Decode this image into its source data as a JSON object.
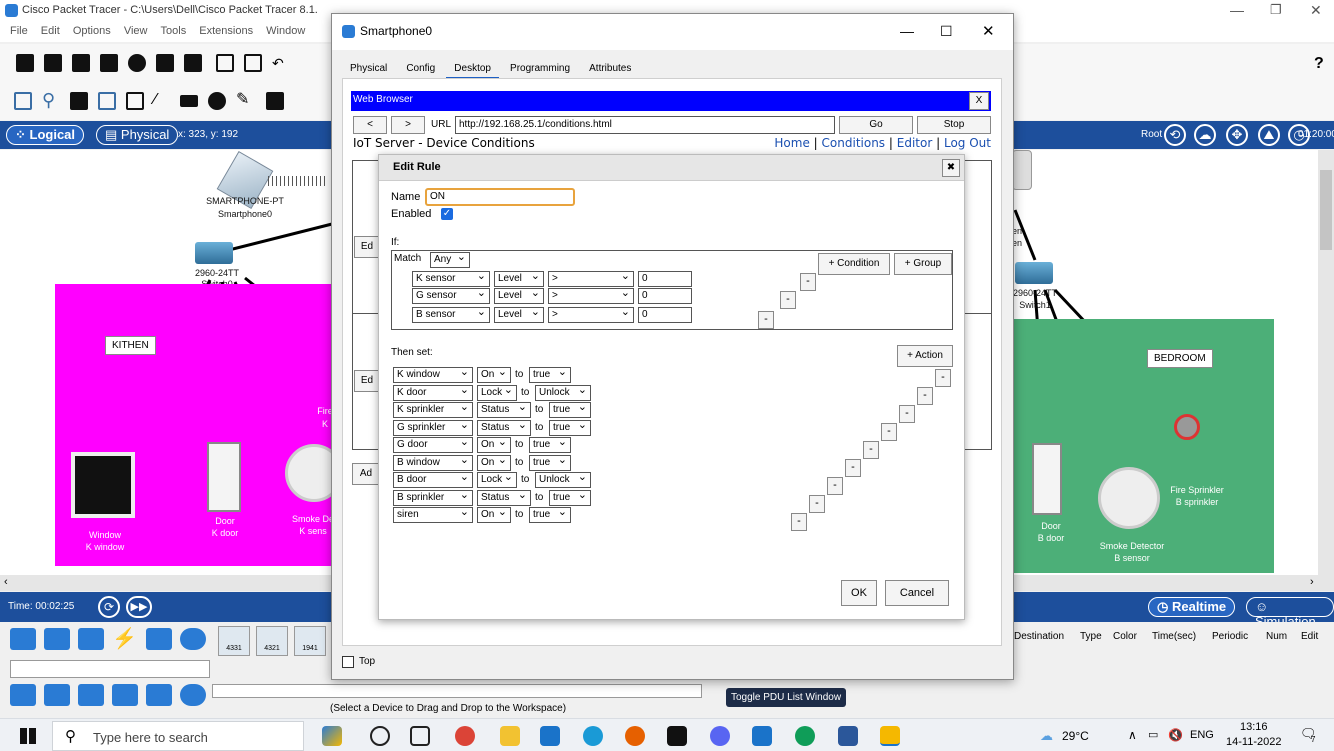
{
  "pt_window": {
    "title": "Cisco Packet Tracer - C:\\Users\\Dell\\Cisco Packet Tracer 8.1.",
    "menu": [
      "File",
      "Edit",
      "Options",
      "View",
      "Tools",
      "Extensions",
      "Window"
    ],
    "mode_logical": "Logical",
    "mode_physical": "Physical",
    "coords": "x: 323, y: 192",
    "root_label": "Root",
    "clock": "01:20:00",
    "help_label": "?"
  },
  "workspace": {
    "smartphone_label_1": "SMARTPHONE-PT",
    "smartphone_label_2": "Smartphone0",
    "switch_label": "2960-24TT",
    "switch_label_2": "Switch0",
    "kitchen_label": "KITHEN",
    "bedroom_label": "BEDROOM",
    "k_window_1": "Window",
    "k_window_2": "K window",
    "k_door_1": "Door",
    "k_door_2": "K door",
    "k_smoke_1": "Smoke De",
    "k_smoke_2": "K sens",
    "k_fire_1": "Fire",
    "k_fire_2": "K",
    "b_door_1": "Door",
    "b_door_2": "B door",
    "b_smoke_1": "Smoke Detector",
    "b_smoke_2": "B sensor",
    "b_fire_1": "Fire Sprinkler",
    "b_fire_2": "B sprinkler",
    "b_switch_label": "2960-24TT",
    "b_switch_label_2": "Switch1",
    "b_top_label_1": "en",
    "b_top_label_2": "en"
  },
  "bottom": {
    "time": "Time: 00:02:25",
    "realtime": "Realtime",
    "simulation": "Simulation",
    "pdu_columns": [
      "Destination",
      "Type",
      "Color",
      "Time(sec)",
      "Periodic",
      "Num",
      "Edit"
    ],
    "device_hint": "(Select a Device to Drag and Drop to the Workspace)",
    "toggle_pdu": "Toggle PDU List Window",
    "router_labels": [
      "4331",
      "4321",
      "1941"
    ]
  },
  "dialog": {
    "title": "Smartphone0",
    "tabs": [
      "Physical",
      "Config",
      "Desktop",
      "Programming",
      "Attributes"
    ],
    "active_tab": "Desktop",
    "web_browser_title": "Web Browser",
    "close_x": "X",
    "nav_back": "<",
    "nav_forward": ">",
    "url_label": "URL",
    "url_value": "http://192.168.25.1/conditions.html",
    "go": "Go",
    "stop": "Stop",
    "iot_title": "IoT Server - Device Conditions",
    "links": {
      "home": "Home",
      "conditions": "Conditions",
      "editor": "Editor",
      "logout": "Log Out",
      "sep": "|"
    },
    "top_checkbox_label": "Top",
    "side_buttons": [
      "Ed",
      "Ed",
      "Ad"
    ]
  },
  "edit_rule": {
    "title": "Edit Rule",
    "close": "✖",
    "name_label": "Name",
    "name_value": "ON",
    "enabled_label": "Enabled",
    "enabled": true,
    "if_label": "If:",
    "match_label": "Match",
    "match_value": "Any",
    "add_condition": "+ Condition",
    "add_group": "+ Group",
    "conditions": [
      {
        "device": "K sensor",
        "property": "Level",
        "op": ">",
        "value": "0"
      },
      {
        "device": "G sensor",
        "property": "Level",
        "op": ">",
        "value": "0"
      },
      {
        "device": "B sensor",
        "property": "Level",
        "op": ">",
        "value": "0"
      }
    ],
    "then_label": "Then set:",
    "add_action": "+ Action",
    "to_label": "to",
    "actions": [
      {
        "device": "K window",
        "property": "On",
        "value": "true"
      },
      {
        "device": "K door",
        "property": "Lock",
        "value": "Unlock"
      },
      {
        "device": "K sprinkler",
        "property": "Status",
        "value": "true"
      },
      {
        "device": "G sprinkler",
        "property": "Status",
        "value": "true"
      },
      {
        "device": "G door",
        "property": "On",
        "value": "true"
      },
      {
        "device": "B window",
        "property": "On",
        "value": "true"
      },
      {
        "device": "B door",
        "property": "Lock",
        "value": "Unlock"
      },
      {
        "device": "B sprinkler",
        "property": "Status",
        "value": "true"
      },
      {
        "device": "siren",
        "property": "On",
        "value": "true"
      }
    ],
    "minus": "-",
    "ok": "OK",
    "cancel": "Cancel"
  },
  "taskbar": {
    "search_placeholder": "Type here to search",
    "weather": "29°C",
    "lang": "ENG",
    "time": "13:16",
    "date": "14-11-2022",
    "notif_count": "7"
  }
}
